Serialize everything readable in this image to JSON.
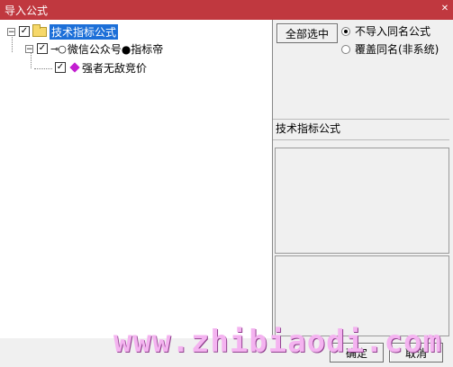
{
  "window": {
    "title": "导入公式",
    "close_glyph": "✕"
  },
  "tree": {
    "root": {
      "label": "技术指标公式",
      "checked": true,
      "expander": "−"
    },
    "child": {
      "label": "微信公众号●指标帝",
      "checked": true,
      "expander": "−"
    },
    "leaf": {
      "label": "强者无敌竞价",
      "checked": true
    }
  },
  "buttons": {
    "select_all": "全部选中",
    "ok": "确定",
    "cancel": "取消"
  },
  "radio_options": [
    {
      "label": "不导入同名公式",
      "selected": true
    },
    {
      "label": "覆盖同名(非系统)",
      "selected": false
    }
  ],
  "info_label": "技术指标公式",
  "watermark": "www.zhibiaodi.com",
  "colors": {
    "titlebar": "#c0383f",
    "selection": "#1c6fd8",
    "watermark": "#f4b3f0"
  }
}
